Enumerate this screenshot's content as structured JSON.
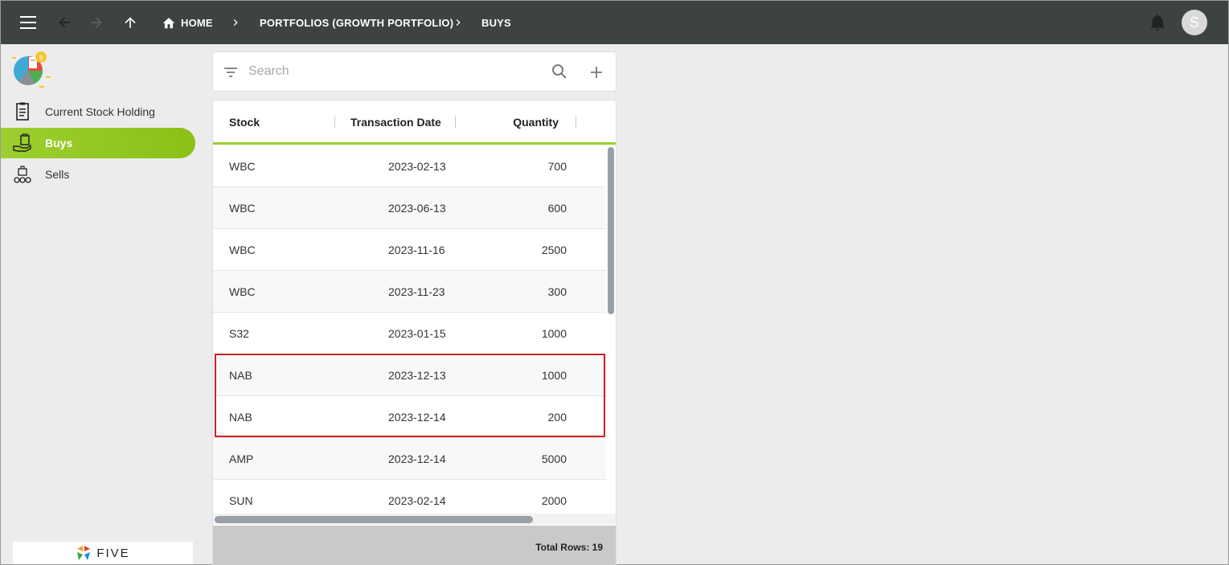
{
  "topbar": {
    "breadcrumbs": [
      {
        "label": "HOME"
      },
      {
        "label": "PORTFOLIOS (GROWTH PORTFOLIO)"
      },
      {
        "label": "BUYS"
      }
    ],
    "avatar_initial": "S"
  },
  "sidebar": {
    "items": [
      {
        "label": "Current Stock Holding",
        "icon": "clipboard-list-icon",
        "active": false
      },
      {
        "label": "Buys",
        "icon": "hand-bag-icon",
        "active": true
      },
      {
        "label": "Sells",
        "icon": "coins-stack-icon",
        "active": false
      }
    ],
    "footer_logo": "FIVE"
  },
  "search": {
    "placeholder": "Search",
    "value": ""
  },
  "table": {
    "columns": [
      "Stock",
      "Transaction Date",
      "Quantity"
    ],
    "rows": [
      {
        "stock": "WBC",
        "date": "2023-02-13",
        "qty": "700"
      },
      {
        "stock": "WBC",
        "date": "2023-06-13",
        "qty": "600"
      },
      {
        "stock": "WBC",
        "date": "2023-11-16",
        "qty": "2500"
      },
      {
        "stock": "WBC",
        "date": "2023-11-23",
        "qty": "300"
      },
      {
        "stock": "S32",
        "date": "2023-01-15",
        "qty": "1000"
      },
      {
        "stock": "NAB",
        "date": "2023-12-13",
        "qty": "1000"
      },
      {
        "stock": "NAB",
        "date": "2023-12-14",
        "qty": "200"
      },
      {
        "stock": "AMP",
        "date": "2023-12-14",
        "qty": "5000"
      },
      {
        "stock": "SUN",
        "date": "2023-02-14",
        "qty": "2000"
      }
    ],
    "footer": "Total Rows: 19"
  },
  "colors": {
    "topbar": "#3c4340",
    "accent": "#9ccf2f",
    "highlight": "#d01f1f"
  }
}
